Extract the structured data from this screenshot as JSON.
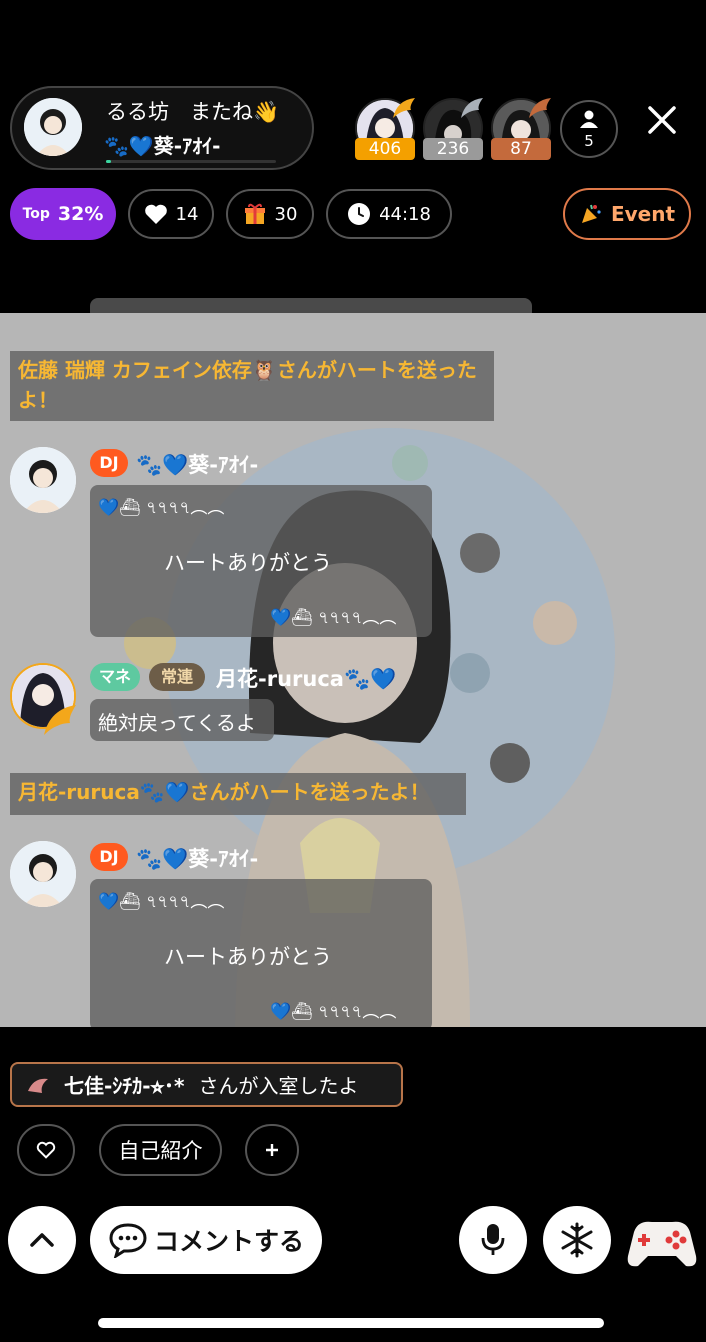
{
  "header": {
    "host": {
      "title": "るる坊　またね👋",
      "name": "🐾💙葵-ｱｵｲ-",
      "progress": 0.03
    },
    "ranking": [
      {
        "score": "406",
        "color": "#f4a000"
      },
      {
        "score": "236",
        "color": "#9a9a9a"
      },
      {
        "score": "87",
        "color": "#c46a3c"
      }
    ],
    "viewer_count": "5",
    "stats": {
      "top_label": "Top",
      "top_value": "32%",
      "hearts": "14",
      "gifts": "30",
      "time": "44:18"
    },
    "event_label": "Event"
  },
  "chat": {
    "sys_msg_1": "佐藤 瑞輝 カフェイン依存🦉さんがハートを送ったよ！",
    "msg_1": {
      "badge": "DJ",
      "user": "🐾💙葵-ｱｵｲ-",
      "header_line": "💙⛴ ৭৭৭৭︵︵",
      "text": "ハートありがとう",
      "footer_line": "💙⛴ ৭৭৭৭︵︵"
    },
    "msg_2": {
      "badge_1": "マネ",
      "badge_2": "常連",
      "user": "月花-ruruca🐾💙",
      "text": "絶対戻ってくるよ"
    },
    "sys_msg_2": "月花-ruruca🐾💙さんがハートを送ったよ！",
    "msg_3": {
      "badge": "DJ",
      "user": "🐾💙葵-ｱｵｲ-",
      "header_line": "💙⛴ ৭৭৭৭︵︵",
      "text": "ハートありがとう",
      "footer_line": "💙⛴ ৭৭৭৭︵︵"
    }
  },
  "bottom": {
    "entry_user": "七佳-ｼﾁｶ-⭐︎･*",
    "entry_suffix": "さんが入室したよ",
    "quick_intro": "自己紹介",
    "comment_label": "コメントする"
  },
  "colors": {
    "accent_purple": "#8a2be2",
    "system_text": "#f7b733",
    "dj_badge": "#ff5a1f",
    "mane_badge": "#5ec9a0",
    "event_border": "#e07a4a"
  },
  "icons": [
    "heart-icon",
    "gift-icon",
    "clock-icon",
    "person-icon",
    "close-icon",
    "party-icon",
    "chevron-up-icon",
    "comment-bubble-icon",
    "mic-icon",
    "snowflake-icon",
    "game-controller-icon",
    "flower-icon"
  ]
}
